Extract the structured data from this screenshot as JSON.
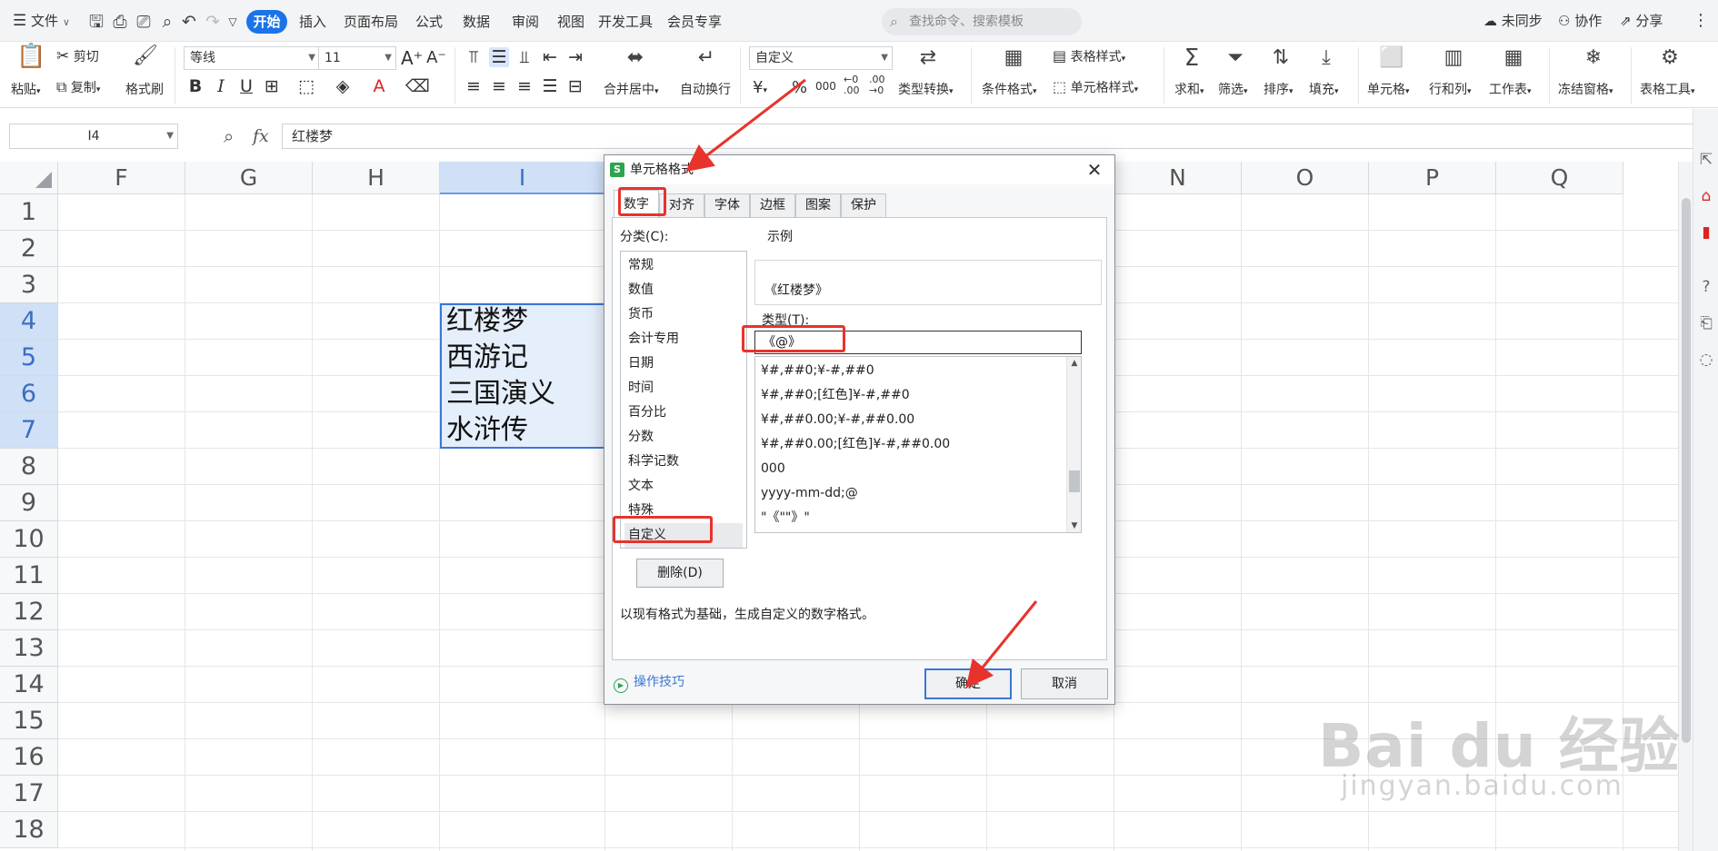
{
  "menubar": {
    "file": "文件",
    "tabs": [
      "开始",
      "插入",
      "页面布局",
      "公式",
      "数据",
      "审阅",
      "视图",
      "开发工具",
      "会员专享"
    ],
    "search_placeholder": "查找命令、搜索模板",
    "unsync": "未同步",
    "collab": "协作",
    "share": "分享"
  },
  "ribbon": {
    "paste": "粘贴",
    "cut": "剪切",
    "copy": "复制",
    "format_painter": "格式刷",
    "font_name": "等线",
    "font_size": "11",
    "number_format": "自定义",
    "merge_center": "合并居中",
    "wrap_text": "自动换行",
    "type_convert": "类型转换",
    "conditional_format": "条件格式",
    "table_style": "表格样式",
    "cell_style": "单元格样式",
    "sum": "求和",
    "filter": "筛选",
    "sort": "排序",
    "fill": "填充",
    "cell": "单元格",
    "row_col": "行和列",
    "worksheet": "工作表",
    "freeze": "冻结窗格",
    "table_tools": "表格工具",
    "currency_symbol": "¥",
    "percent_symbol": "%",
    "thousands": "000",
    "inc_dec": "←0 .00",
    "dec_dec": ".00 →0"
  },
  "formula": {
    "cell_ref": "I4",
    "fx": "fx",
    "value": "红楼梦"
  },
  "grid": {
    "columns": [
      "F",
      "G",
      "H",
      "I",
      "J",
      "K",
      "L",
      "M",
      "N",
      "O",
      "P",
      "Q"
    ],
    "rows": [
      "1",
      "2",
      "3",
      "4",
      "5",
      "6",
      "7",
      "8",
      "9",
      "10",
      "11",
      "12",
      "13",
      "14",
      "15",
      "16",
      "17",
      "18"
    ],
    "cells": [
      "红楼梦",
      "西游记",
      "三国演义",
      "水浒传"
    ]
  },
  "dialog": {
    "title": "单元格格式",
    "logo": "S",
    "tabs": [
      "数字",
      "对齐",
      "字体",
      "边框",
      "图案",
      "保护"
    ],
    "category_label": "分类(C):",
    "categories": [
      "常规",
      "数值",
      "货币",
      "会计专用",
      "日期",
      "时间",
      "百分比",
      "分数",
      "科学记数",
      "文本",
      "特殊",
      "自定义"
    ],
    "sample_label": "示例",
    "sample_value": "《红楼梦》",
    "type_label": "类型(T):",
    "type_value": "《@》",
    "formats": [
      "¥#,##0;¥-#,##0",
      "¥#,##0;[红色]¥-#,##0",
      "¥#,##0.00;¥-#,##0.00",
      "¥#,##0.00;[红色]¥-#,##0.00",
      "000",
      "yyyy-mm-dd;@",
      "\"《\"\"》\""
    ],
    "delete_button": "删除(D)",
    "hint": "以现有格式为基础，生成自定义的数字格式。",
    "tips": "操作技巧",
    "ok": "确定",
    "cancel": "取消"
  },
  "watermark": {
    "main": "Bai du 经验",
    "sub": "jingyan.baidu.com"
  },
  "colors": {
    "accent": "#1a73e8",
    "highlight": "#e8332c",
    "selection": "#3a78d4"
  }
}
